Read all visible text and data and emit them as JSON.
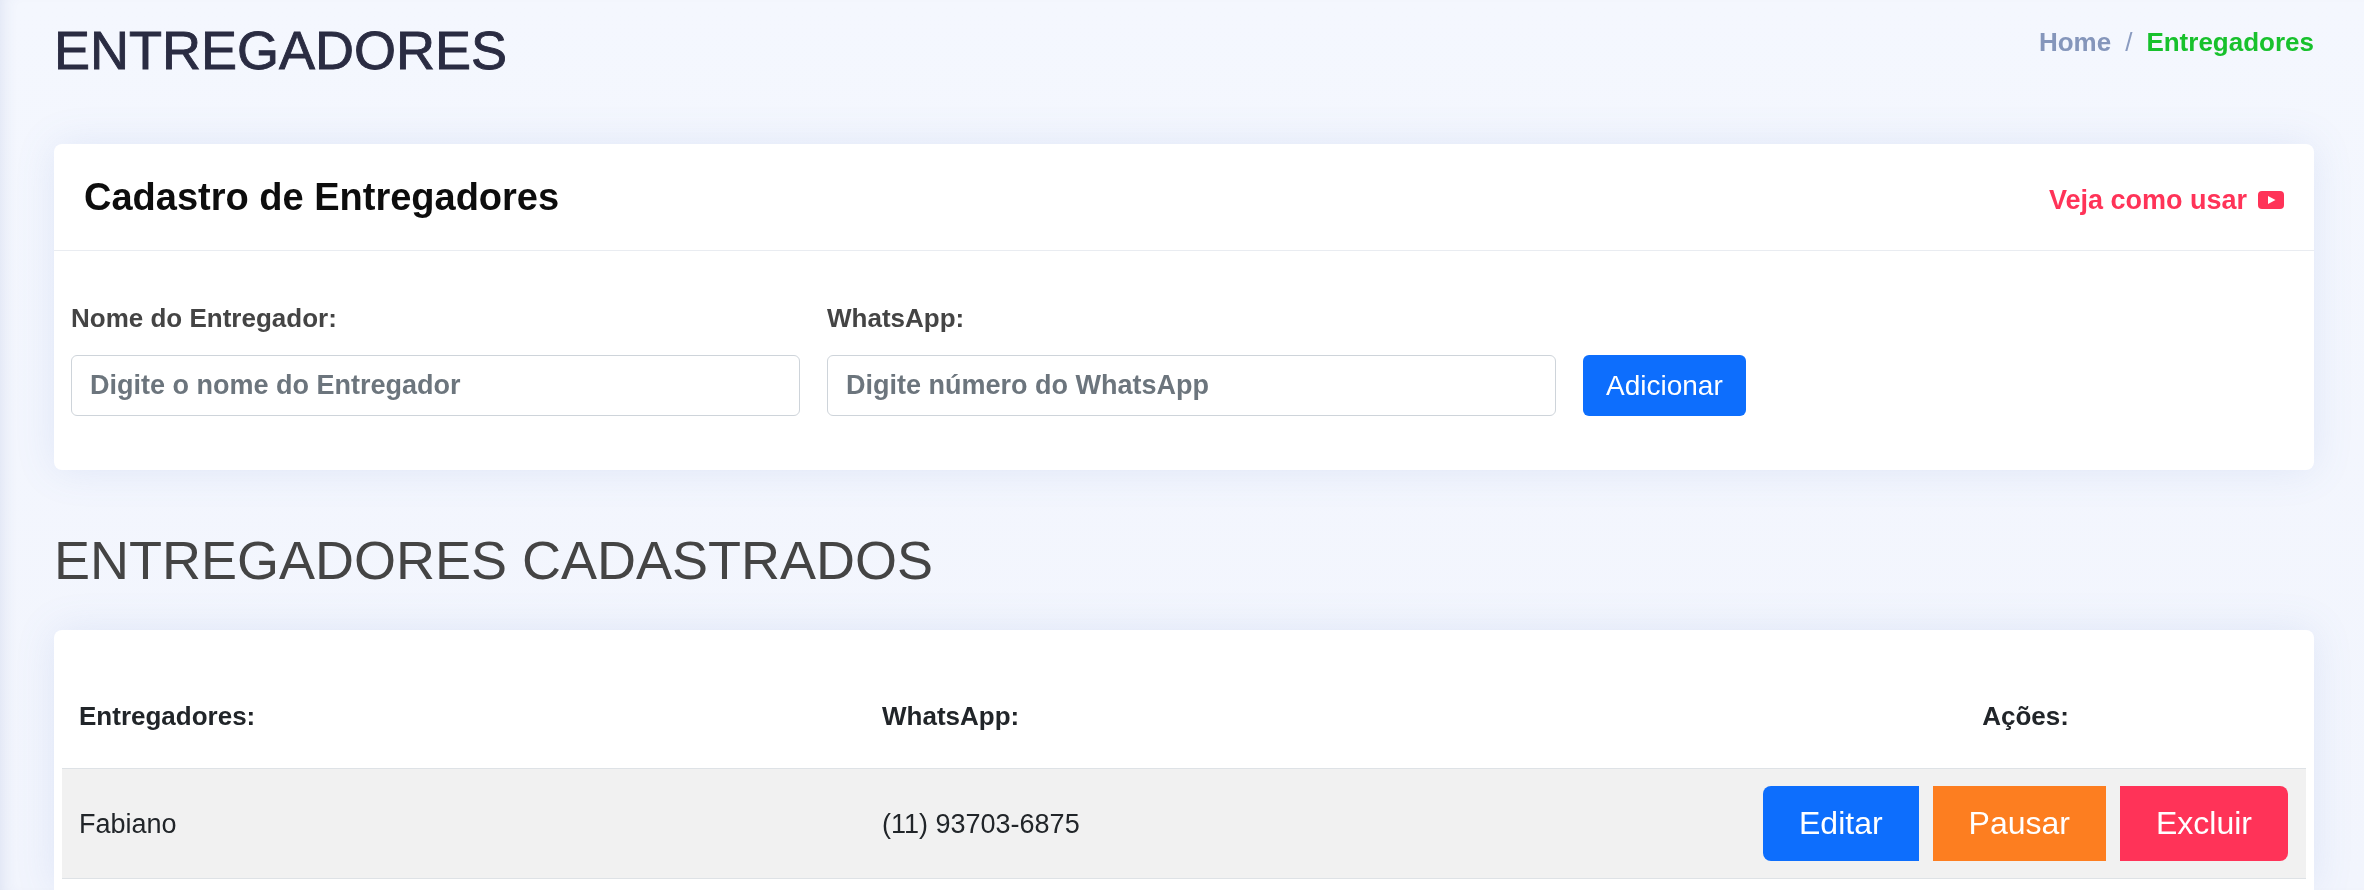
{
  "page": {
    "title": "ENTREGADORES"
  },
  "breadcrumb": {
    "separator": "/",
    "items": [
      {
        "label": "Home",
        "current": false
      },
      {
        "label": "Entregadores",
        "current": true
      }
    ]
  },
  "form_card": {
    "title": "Cadastro de Entregadores",
    "help_link": "Veja como usar",
    "fields": [
      {
        "label": "Nome do Entregador:",
        "placeholder": "Digite o nome do Entregador"
      },
      {
        "label": "WhatsApp:",
        "placeholder": "Digite número do WhatsApp"
      }
    ],
    "submit_button": "Adicionar"
  },
  "list_section": {
    "title": "ENTREGADORES CADASTRADOS"
  },
  "table": {
    "columns": [
      "Entregadores:",
      "WhatsApp:",
      "Ações:"
    ],
    "rows": [
      {
        "cells": [
          "Fabiano",
          "(11) 93703-6875"
        ],
        "actions": [
          {
            "label": "Editar",
            "kind": "edit"
          },
          {
            "label": "Pausar",
            "kind": "pause"
          },
          {
            "label": "Excluir",
            "kind": "delete"
          }
        ]
      }
    ]
  }
}
